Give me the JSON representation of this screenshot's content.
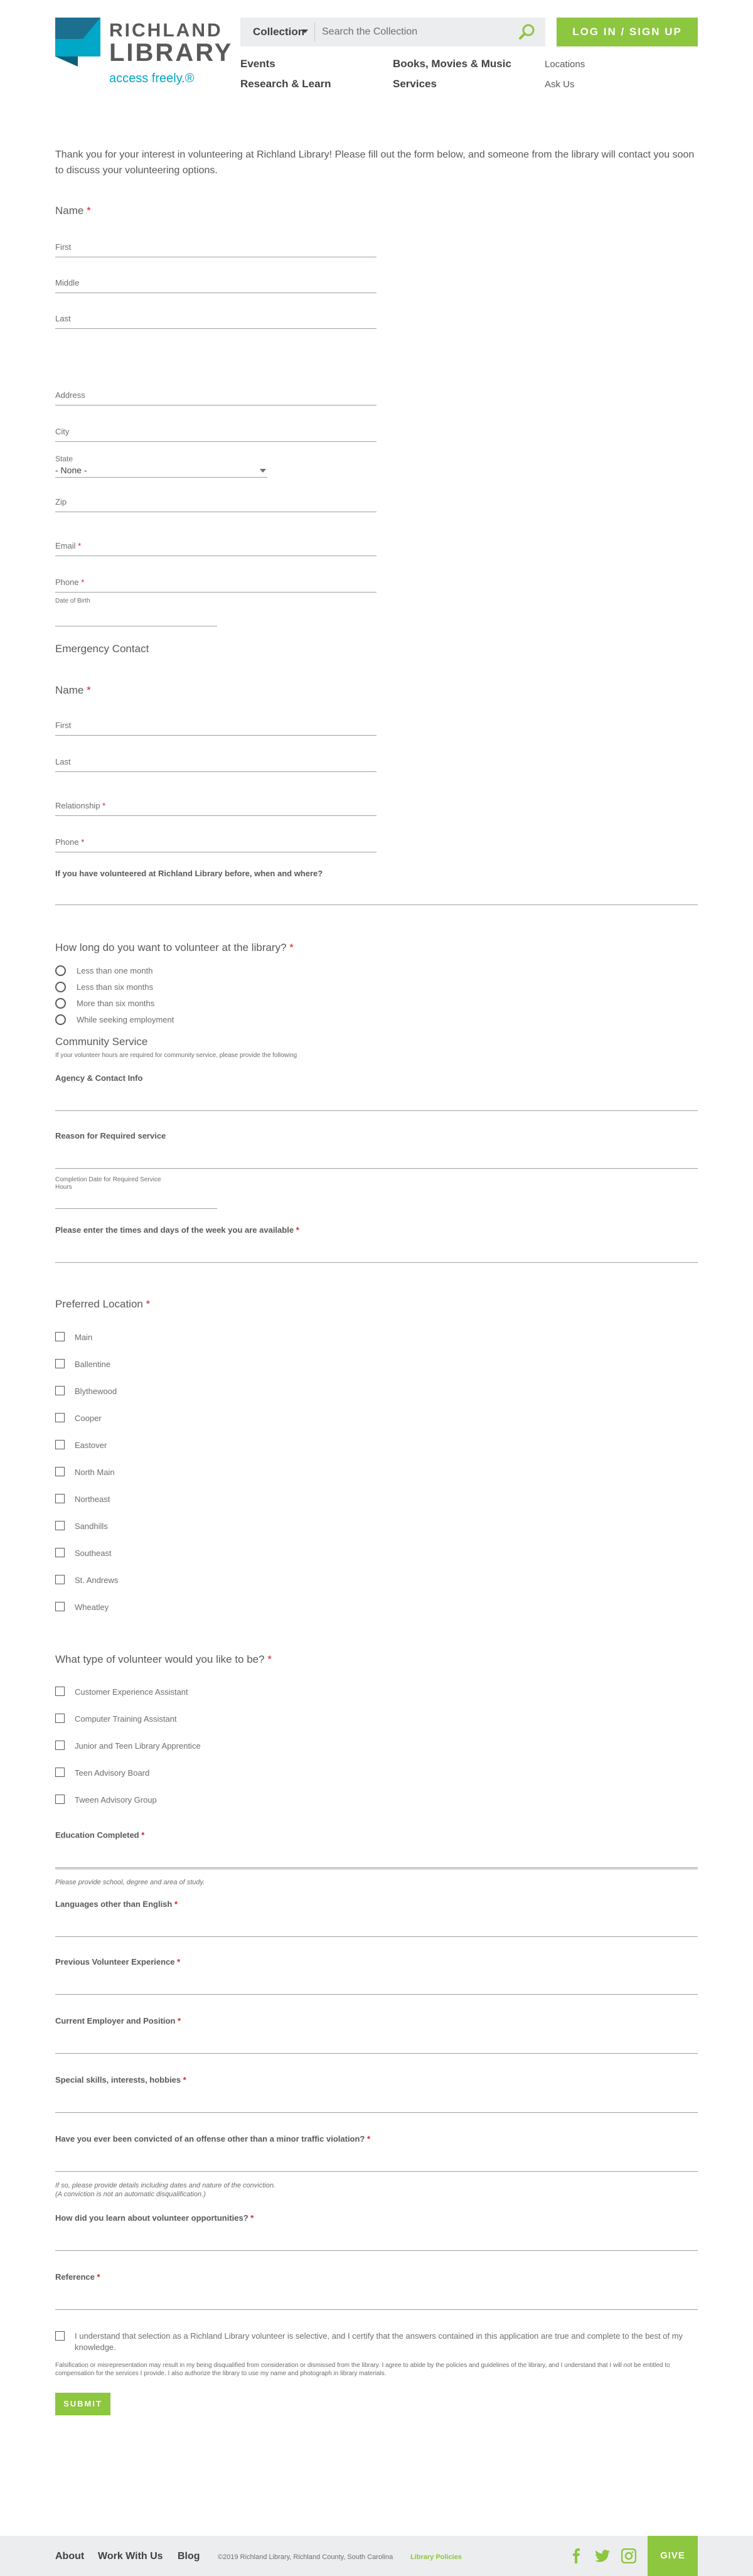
{
  "header": {
    "logo": {
      "word1": "RICHLAND",
      "word2": "LIBRARY",
      "tagline": "access freely.®"
    },
    "search": {
      "collection_label": "Collection",
      "placeholder": "Search the Collection"
    },
    "login_label": "LOG IN / SIGN UP",
    "nav": {
      "events": "Events",
      "books": "Books, Movies & Music",
      "locations": "Locations",
      "research": "Research & Learn",
      "services": "Services",
      "ask_us": "Ask Us"
    }
  },
  "form": {
    "intro": "Thank you for your interest in volunteering at Richland Library! Please fill out the form below, and someone from the library will contact you soon to discuss your volunteering options.",
    "name_label": "Name",
    "first": "First",
    "middle": "Middle",
    "last": "Last",
    "address": "Address",
    "city": "City",
    "state_label": "State",
    "state_value": "- None -",
    "zip": "Zip",
    "email": "Email",
    "phone": "Phone",
    "dob": "Date of Birth",
    "emergency_heading": "Emergency Contact",
    "ec_name_label": "Name",
    "ec_first": "First",
    "ec_last": "Last",
    "relationship": "Relationship",
    "ec_phone": "Phone",
    "prev_volunteer_q": "If you have volunteered at Richland Library before, when and where?",
    "duration_q": "How long do you want to volunteer at the library?",
    "duration_options": [
      "Less than one month",
      "Less than six months",
      "More than six months",
      "While seeking employment"
    ],
    "community_heading": "Community Service",
    "community_note": "If your volunteer hours are required for community service, please provide the following",
    "agency_label": "Agency & Contact Info",
    "reason_label": "Reason for Required service",
    "completion_label": "Completion Date for Required Service",
    "hours_label": "Hours",
    "times_q": "Please enter the times and days of the week you are available",
    "location_q": "Preferred Location",
    "locations": [
      "Main",
      "Ballentine",
      "Blythewood",
      "Cooper",
      "Eastover",
      "North Main",
      "Northeast",
      "Sandhills",
      "Southeast",
      "St. Andrews",
      "Wheatley"
    ],
    "type_q": "What type of volunteer would you like to be?",
    "types": [
      "Customer Experience Assistant",
      "Computer Training Assistant",
      "Junior and Teen Library Apprentice",
      "Teen Advisory Board",
      "Tween Advisory Group"
    ],
    "education_label": "Education Completed",
    "education_note": "Please provide school, degree and area of study.",
    "languages_label": "Languages other than English",
    "prev_experience_label": "Previous Volunteer Experience",
    "employer_label": "Current Employer and Position",
    "skills_label": "Special skills, interests, hobbies",
    "convicted_label": "Have you ever been convicted of an offense other than a minor traffic violation?",
    "convicted_note1": "If so, please provide details including dates and nature of the conviction.",
    "convicted_note2": "(A conviction is not an automatic disqualification.)",
    "learn_label": "How did you learn about volunteer opportunities?",
    "reference_label": "Reference",
    "certify_text": "I understand that selection as a Richland Library volunteer is selective, and I certify that the answers contained in this application are true and complete to the best of my knowledge.",
    "certify_note": "Falsification or misrepresentation may result in my being disqualified from consideration or dismissed from the library. I agree to abide by the policies and guidelines of the library, and I understand that I will not be entitled to compensation for the services I provide. I also authorize the library to use my name and photograph in library materials.",
    "submit_label": "SUBMIT"
  },
  "footer": {
    "about": "About",
    "work": "Work With Us",
    "blog": "Blog",
    "copyright": "©2019 Richland Library, Richland County, South Carolina",
    "policies": "Library Policies",
    "give": "GIVE"
  },
  "colors": {
    "accent_green": "#8dc63f",
    "brand_teal": "#00a7c6",
    "required_red": "#d6222a"
  }
}
